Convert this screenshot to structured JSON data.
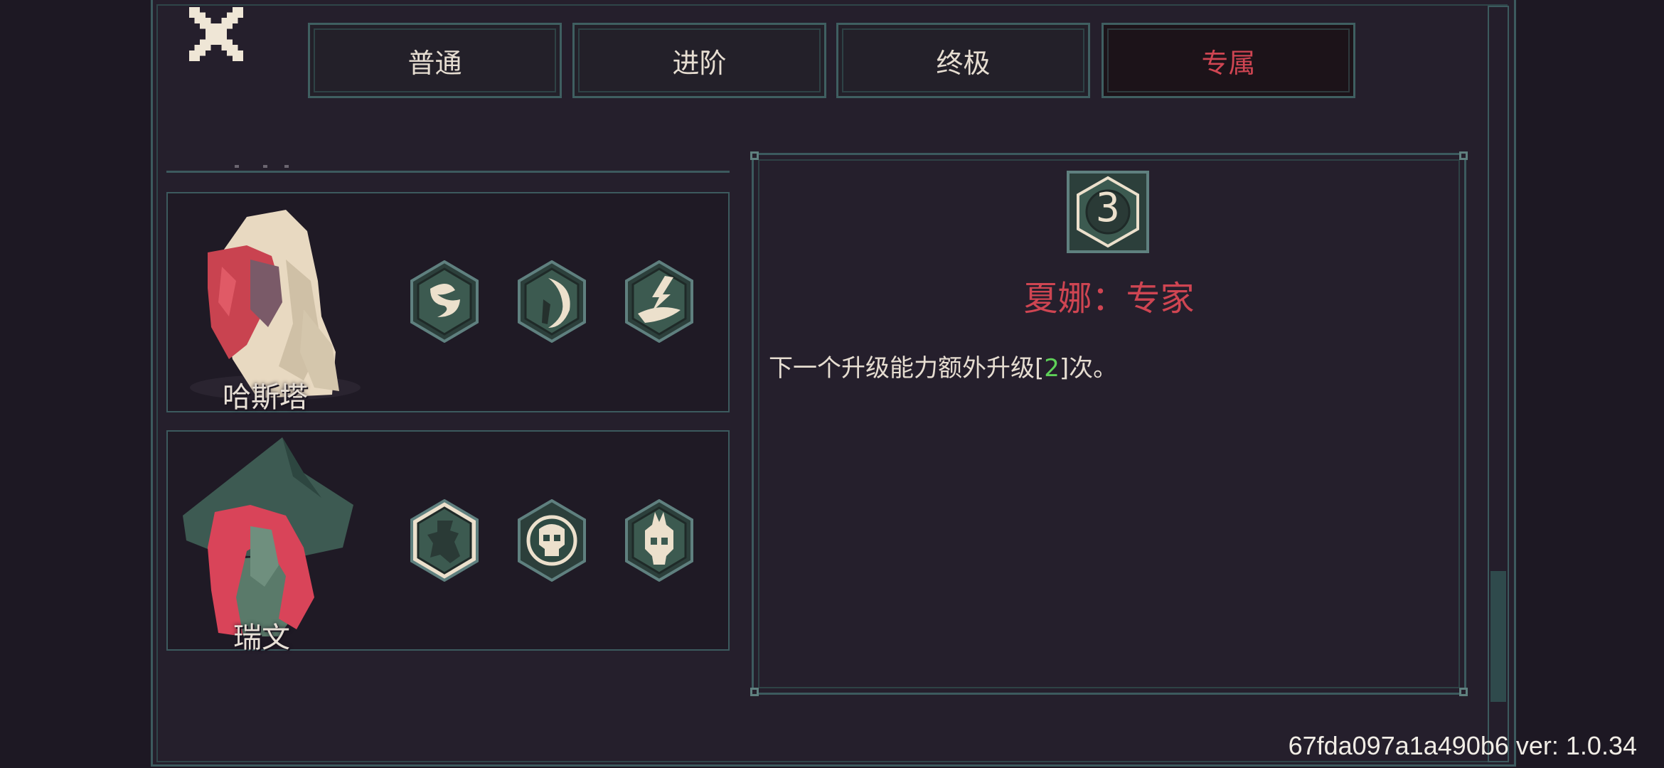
{
  "tabs": [
    {
      "label": "普通",
      "active": false
    },
    {
      "label": "进阶",
      "active": false
    },
    {
      "label": "终极",
      "active": false
    },
    {
      "label": "专属",
      "active": true
    }
  ],
  "characters": [
    {
      "name": "哈斯塔",
      "abilities": [
        "swirl-icon",
        "crescent-icon",
        "lightning-wind-icon"
      ]
    },
    {
      "name": "瑞文",
      "abilities": [
        "goblin-icon",
        "skull-icon",
        "horned-skull-icon"
      ]
    }
  ],
  "detail": {
    "badge": "3",
    "title": "夏娜：专家",
    "desc_prefix": "下一个升级能力额外升级[",
    "desc_num": "2",
    "desc_suffix": "]次。"
  },
  "footer": {
    "version": "67fda097a1a490b6 ver: 1.0.34"
  },
  "colors": {
    "background": "#201a27",
    "panel": "#251f2c",
    "border": "#3c5a5e",
    "accent_red": "#cf4552",
    "accent_green": "#5ed158",
    "text": "#e6ddd1"
  }
}
